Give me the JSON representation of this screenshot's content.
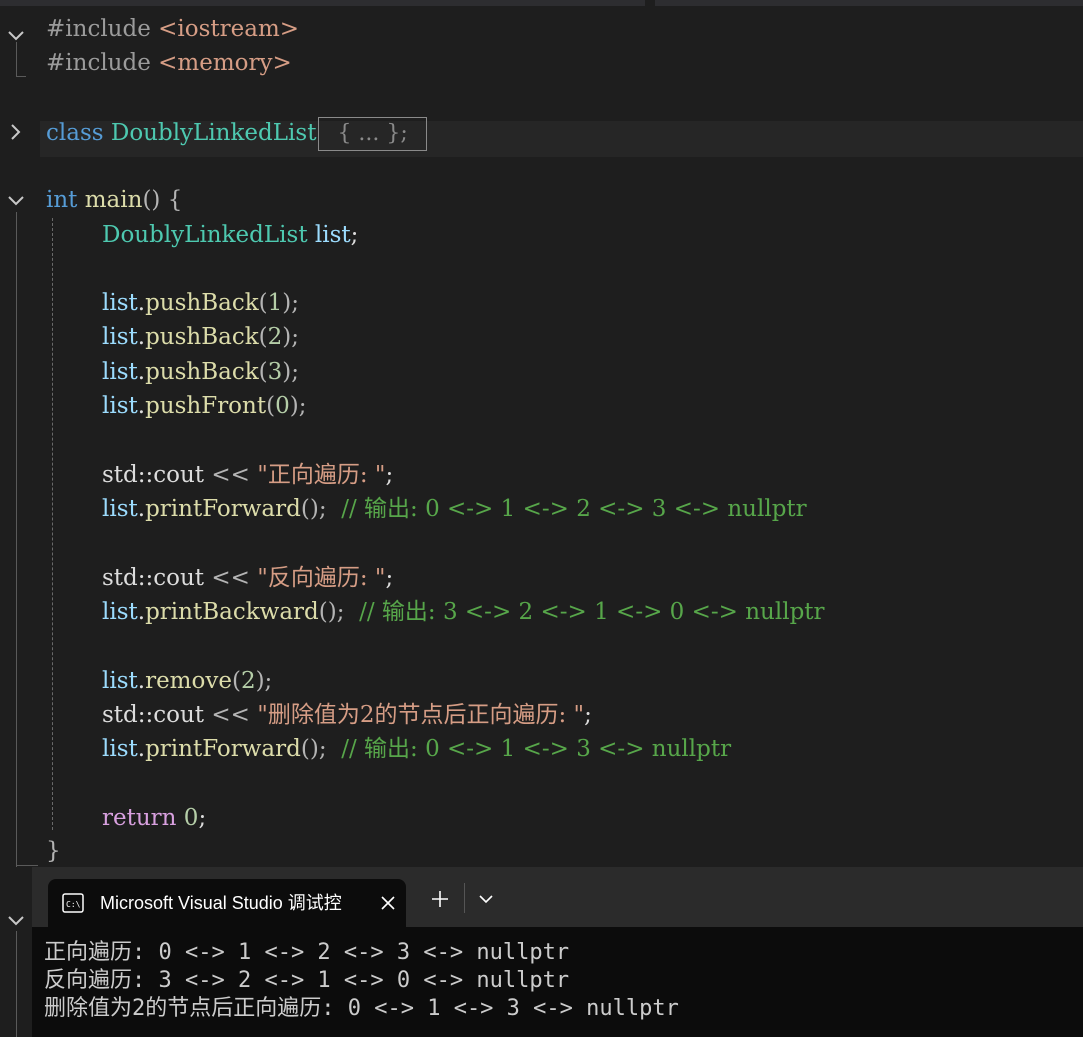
{
  "editor": {
    "lines": {
      "inc1_kw": "#include",
      "inc1_hdr": " <iostream>",
      "inc2_kw": "#include",
      "inc2_hdr": " <memory>",
      "class_kw": "class",
      "class_name": " DoublyLinkedList",
      "class_collapsed": "{ ... };",
      "main_type": "int",
      "main_name": " main",
      "main_rest": "() {",
      "decl_type": "DoublyLinkedList",
      "decl_var": " list",
      "decl_end": ";",
      "pb1_var": "list",
      "pb1_dot": ".",
      "pb1_fn": "pushBack",
      "pb1_open": "(",
      "pb1_num": "1",
      "pb1_close": ");",
      "pb2_var": "list",
      "pb2_dot": ".",
      "pb2_fn": "pushBack",
      "pb2_open": "(",
      "pb2_num": "2",
      "pb2_close": ");",
      "pb3_var": "list",
      "pb3_dot": ".",
      "pb3_fn": "pushBack",
      "pb3_open": "(",
      "pb3_num": "3",
      "pb3_close": ");",
      "pf_var": "list",
      "pf_dot": ".",
      "pf_fn": "pushFront",
      "pf_open": "(",
      "pf_num": "0",
      "pf_close": ");",
      "cout1_ns": "std::cout",
      "cout1_op": " << ",
      "cout1_str": "\"正向遍历: \"",
      "cout1_end": ";",
      "pfw1_var": "list",
      "pfw1_dot": ".",
      "pfw1_fn": "printForward",
      "pfw1_end": "();  ",
      "pfw1_cmt": "// 输出: 0 <-> 1 <-> 2 <-> 3 <-> nullptr",
      "cout2_ns": "std::cout",
      "cout2_op": " << ",
      "cout2_str": "\"反向遍历: \"",
      "cout2_end": ";",
      "pbw_var": "list",
      "pbw_dot": ".",
      "pbw_fn": "printBackward",
      "pbw_end": "();  ",
      "pbw_cmt": "// 输出: 3 <-> 2 <-> 1 <-> 0 <-> nullptr",
      "rm_var": "list",
      "rm_dot": ".",
      "rm_fn": "remove",
      "rm_open": "(",
      "rm_num": "2",
      "rm_close": ");",
      "cout3_ns": "std::cout",
      "cout3_op": " << ",
      "cout3_str": "\"删除值为2的节点后正向遍历: \"",
      "cout3_end": ";",
      "pfw2_var": "list",
      "pfw2_dot": ".",
      "pfw2_fn": "printForward",
      "pfw2_end": "();  ",
      "pfw2_cmt": "// 输出: 0 <-> 1 <-> 3 <-> nullptr",
      "ret_kw": "return",
      "ret_num": " 0",
      "ret_end": ";",
      "close_brace": "}"
    }
  },
  "terminal": {
    "tab_title": "Microsoft Visual Studio 调试控",
    "output": [
      "正向遍历: 0 <-> 1 <-> 2 <-> 3 <-> nullptr",
      "反向遍历: 3 <-> 2 <-> 1 <-> 0 <-> nullptr",
      "删除值为2的节点后正向遍历: 0 <-> 1 <-> 3 <-> nullptr"
    ]
  },
  "icons": {
    "fold_expanded": "chevron-down-icon",
    "fold_collapsed": "chevron-right-icon",
    "terminal": "terminal-icon",
    "close": "close-icon",
    "new_tab": "plus-icon",
    "dropdown": "chevron-down-icon"
  },
  "colors": {
    "editor_bg": "#1e1e1e",
    "keyword": "#569cd6",
    "type": "#4ec9b0",
    "function": "#dcdcaa",
    "variable": "#9cdcfe",
    "string": "#d69d85",
    "comment": "#57a64a",
    "terminal_bg": "#0c0c0c"
  }
}
